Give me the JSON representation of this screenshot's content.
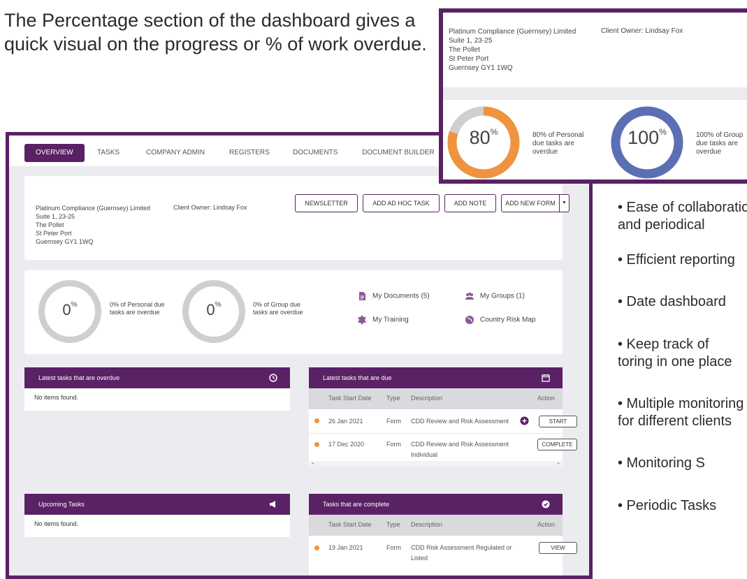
{
  "intro_text": "The Percentage section of the dashboard gives a quick visual on the progress or % of work overdue.",
  "nav": {
    "overview": "OVERVIEW",
    "tasks": "TASKS",
    "company_admin": "COMPANY ADMIN",
    "registers": "REGISTERS",
    "documents": "DOCUMENTS",
    "document_builder": "DOCUMENT BUILDER"
  },
  "company": {
    "name": "Platinum Compliance (Guernsey) Limited",
    "address": [
      "Suite 1, 23-25",
      "The Pollet",
      "St Peter Port",
      "Guernsey GY1 1WQ"
    ],
    "client_owner": "Client Owner: Lindsay Fox"
  },
  "actions": {
    "newsletter": "NEWSLETTER",
    "add_ad_hoc_task": "ADD AD HOC TASK",
    "add_note": "ADD NOTE",
    "add_new_form": "ADD NEW FORM"
  },
  "stats": {
    "personal": {
      "value": "0",
      "unit": "%",
      "label": "0% of Personal due tasks are overdue"
    },
    "group": {
      "value": "0",
      "unit": "%",
      "label": "0% of Group due tasks are overdue"
    }
  },
  "quick_links": {
    "my_documents": "My Documents (5)",
    "my_groups": "My Groups (1)",
    "my_training": "My Training",
    "country_risk_map": "Country Risk Map"
  },
  "panels": {
    "overdue": {
      "title": "Latest tasks that are overdue",
      "empty": "No items found."
    },
    "upcoming": {
      "title": "Upcoming Tasks",
      "empty": "No items found."
    },
    "due": {
      "title": "Latest tasks that are due",
      "columns": [
        "Task Start Date",
        "Type",
        "Description",
        "Action"
      ],
      "rows": [
        {
          "date": "26 Jan 2021",
          "type": "Form",
          "description": "CDD Review and Risk Assessment",
          "action": "START"
        },
        {
          "date": "17 Dec 2020",
          "type": "Form",
          "description": "CDD Review and Risk Assessment",
          "description2": "Individual",
          "action": "COMPLETE"
        }
      ]
    },
    "complete": {
      "title": "Tasks that are complete",
      "columns": [
        "Task Start Date",
        "Type",
        "Description",
        "Action"
      ],
      "rows": [
        {
          "date": "19 Jan 2021",
          "type": "Form",
          "description": "CDD Risk Assessment Regulated or",
          "description2": "Listed",
          "action": "VIEW"
        }
      ]
    }
  },
  "inset": {
    "personal": {
      "value": "80",
      "unit": "%",
      "label": "80% of Personal due tasks are overdue",
      "fraction": 0.8
    },
    "group": {
      "value": "100",
      "unit": "%",
      "label": "100% of Group due tasks are overdue",
      "fraction": 1.0
    }
  },
  "bullets": [
    "• Ease of collaboration",
    "and periodical",
    "• Efficient reporting",
    "• Date dashboard",
    "• Keep track of",
    "toring in one place",
    "• Multiple monitoring",
    "for different clients",
    "• Monitoring S",
    "• Periodic Tasks"
  ],
  "colors": {
    "brand": "#5a2165",
    "personal_ring": "#f0933f",
    "group_ring": "#5b6fb5",
    "ring_track": "#cfcfcf"
  }
}
